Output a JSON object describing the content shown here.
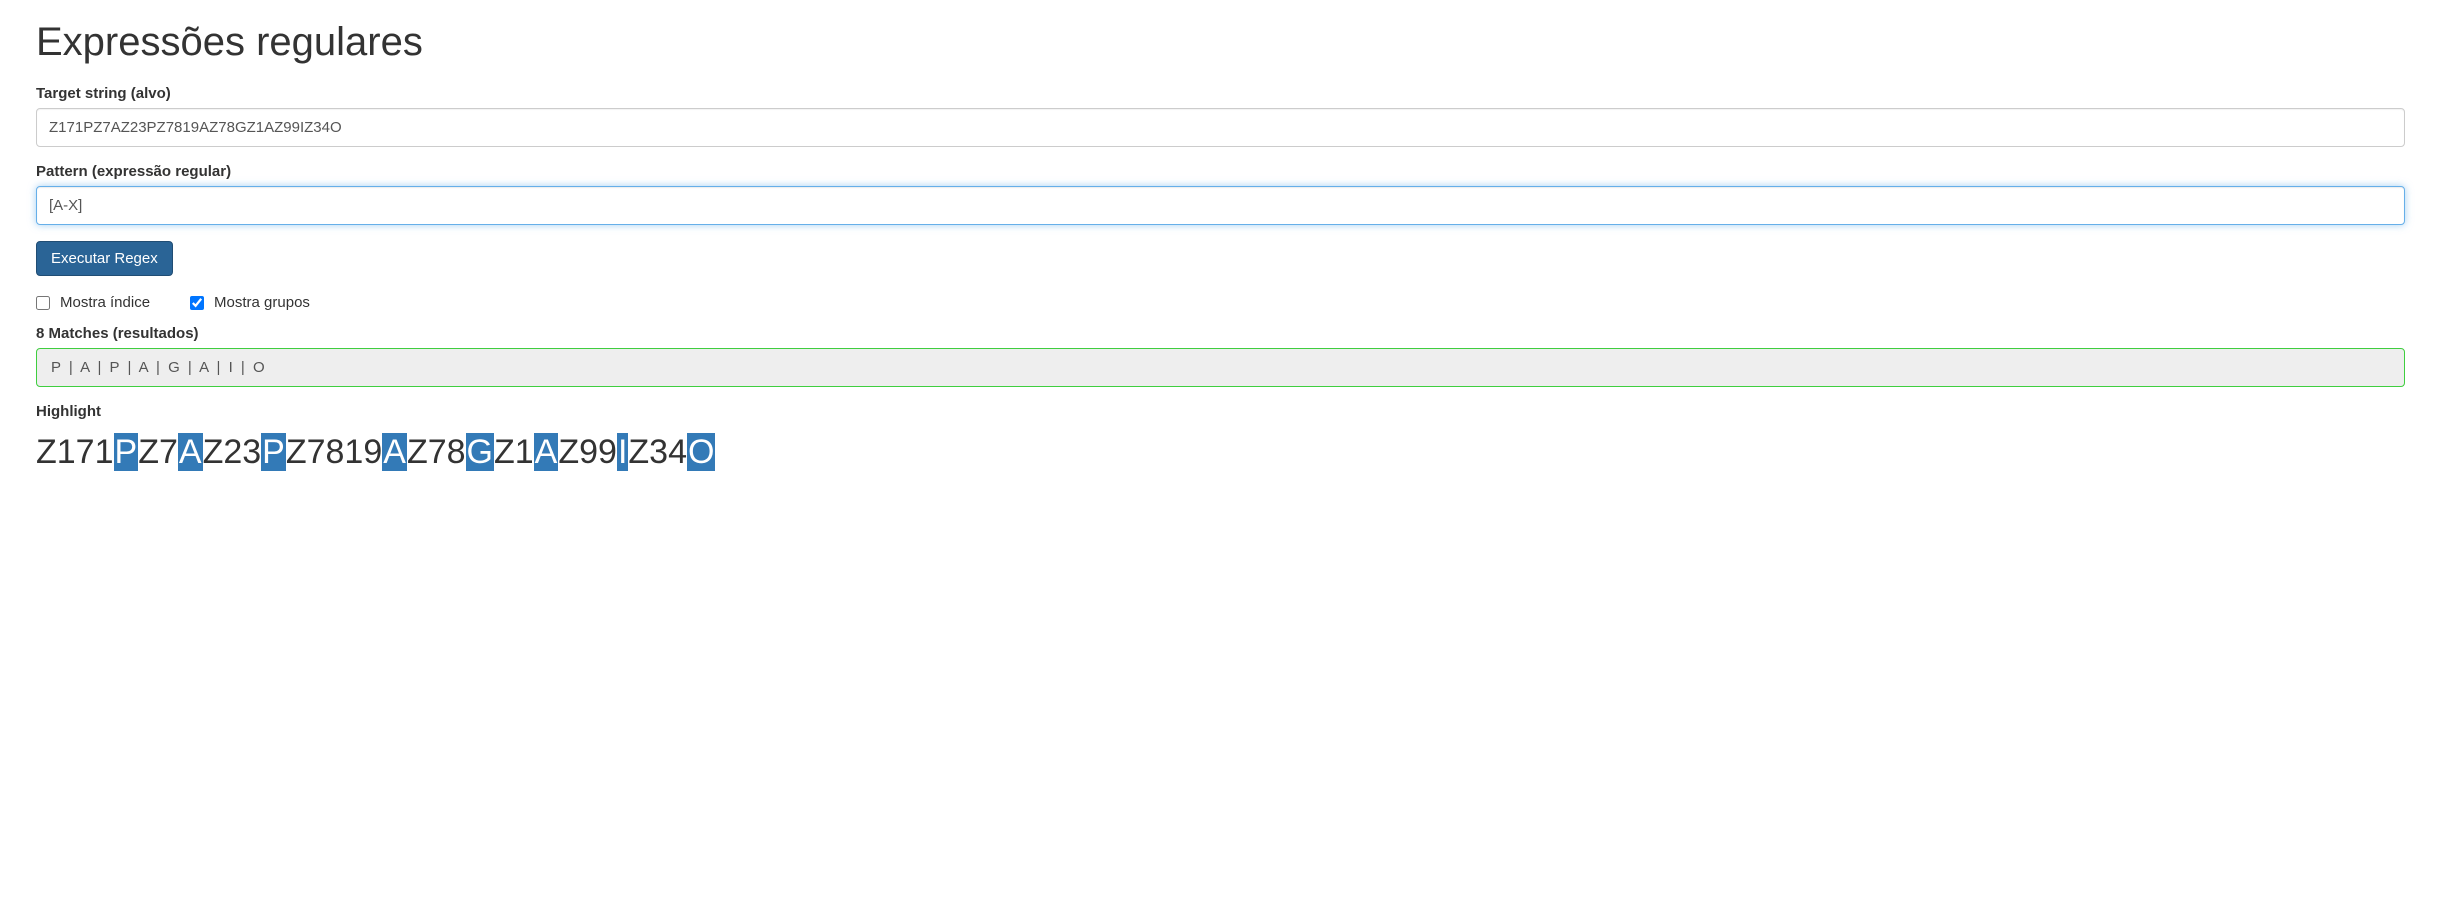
{
  "title": "Expressões regulares",
  "target": {
    "label": "Target string (alvo)",
    "value": "Z171PZ7AZ23PZ7819AZ78GZ1AZ99IZ34O"
  },
  "pattern": {
    "label": "Pattern (expressão regular)",
    "value": "[A-X]"
  },
  "execute_label": "Executar Regex",
  "options": {
    "show_index": {
      "label": "Mostra índice",
      "checked": false
    },
    "show_groups": {
      "label": "Mostra grupos",
      "checked": true
    }
  },
  "results": {
    "label": "8 Matches (resultados)",
    "items": [
      "P",
      "A",
      "P",
      "A",
      "G",
      "A",
      "I",
      "O"
    ]
  },
  "highlight": {
    "label": "Highlight",
    "segments": [
      {
        "text": "Z171",
        "hl": false
      },
      {
        "text": "P",
        "hl": true
      },
      {
        "text": "Z7",
        "hl": false
      },
      {
        "text": "A",
        "hl": true
      },
      {
        "text": "Z23",
        "hl": false
      },
      {
        "text": "P",
        "hl": true
      },
      {
        "text": "Z7819",
        "hl": false
      },
      {
        "text": "A",
        "hl": true
      },
      {
        "text": "Z78",
        "hl": false
      },
      {
        "text": "G",
        "hl": true
      },
      {
        "text": "Z1",
        "hl": false
      },
      {
        "text": "A",
        "hl": true
      },
      {
        "text": "Z99",
        "hl": false
      },
      {
        "text": "I",
        "hl": true
      },
      {
        "text": "Z34",
        "hl": false
      },
      {
        "text": "O",
        "hl": true
      }
    ]
  }
}
